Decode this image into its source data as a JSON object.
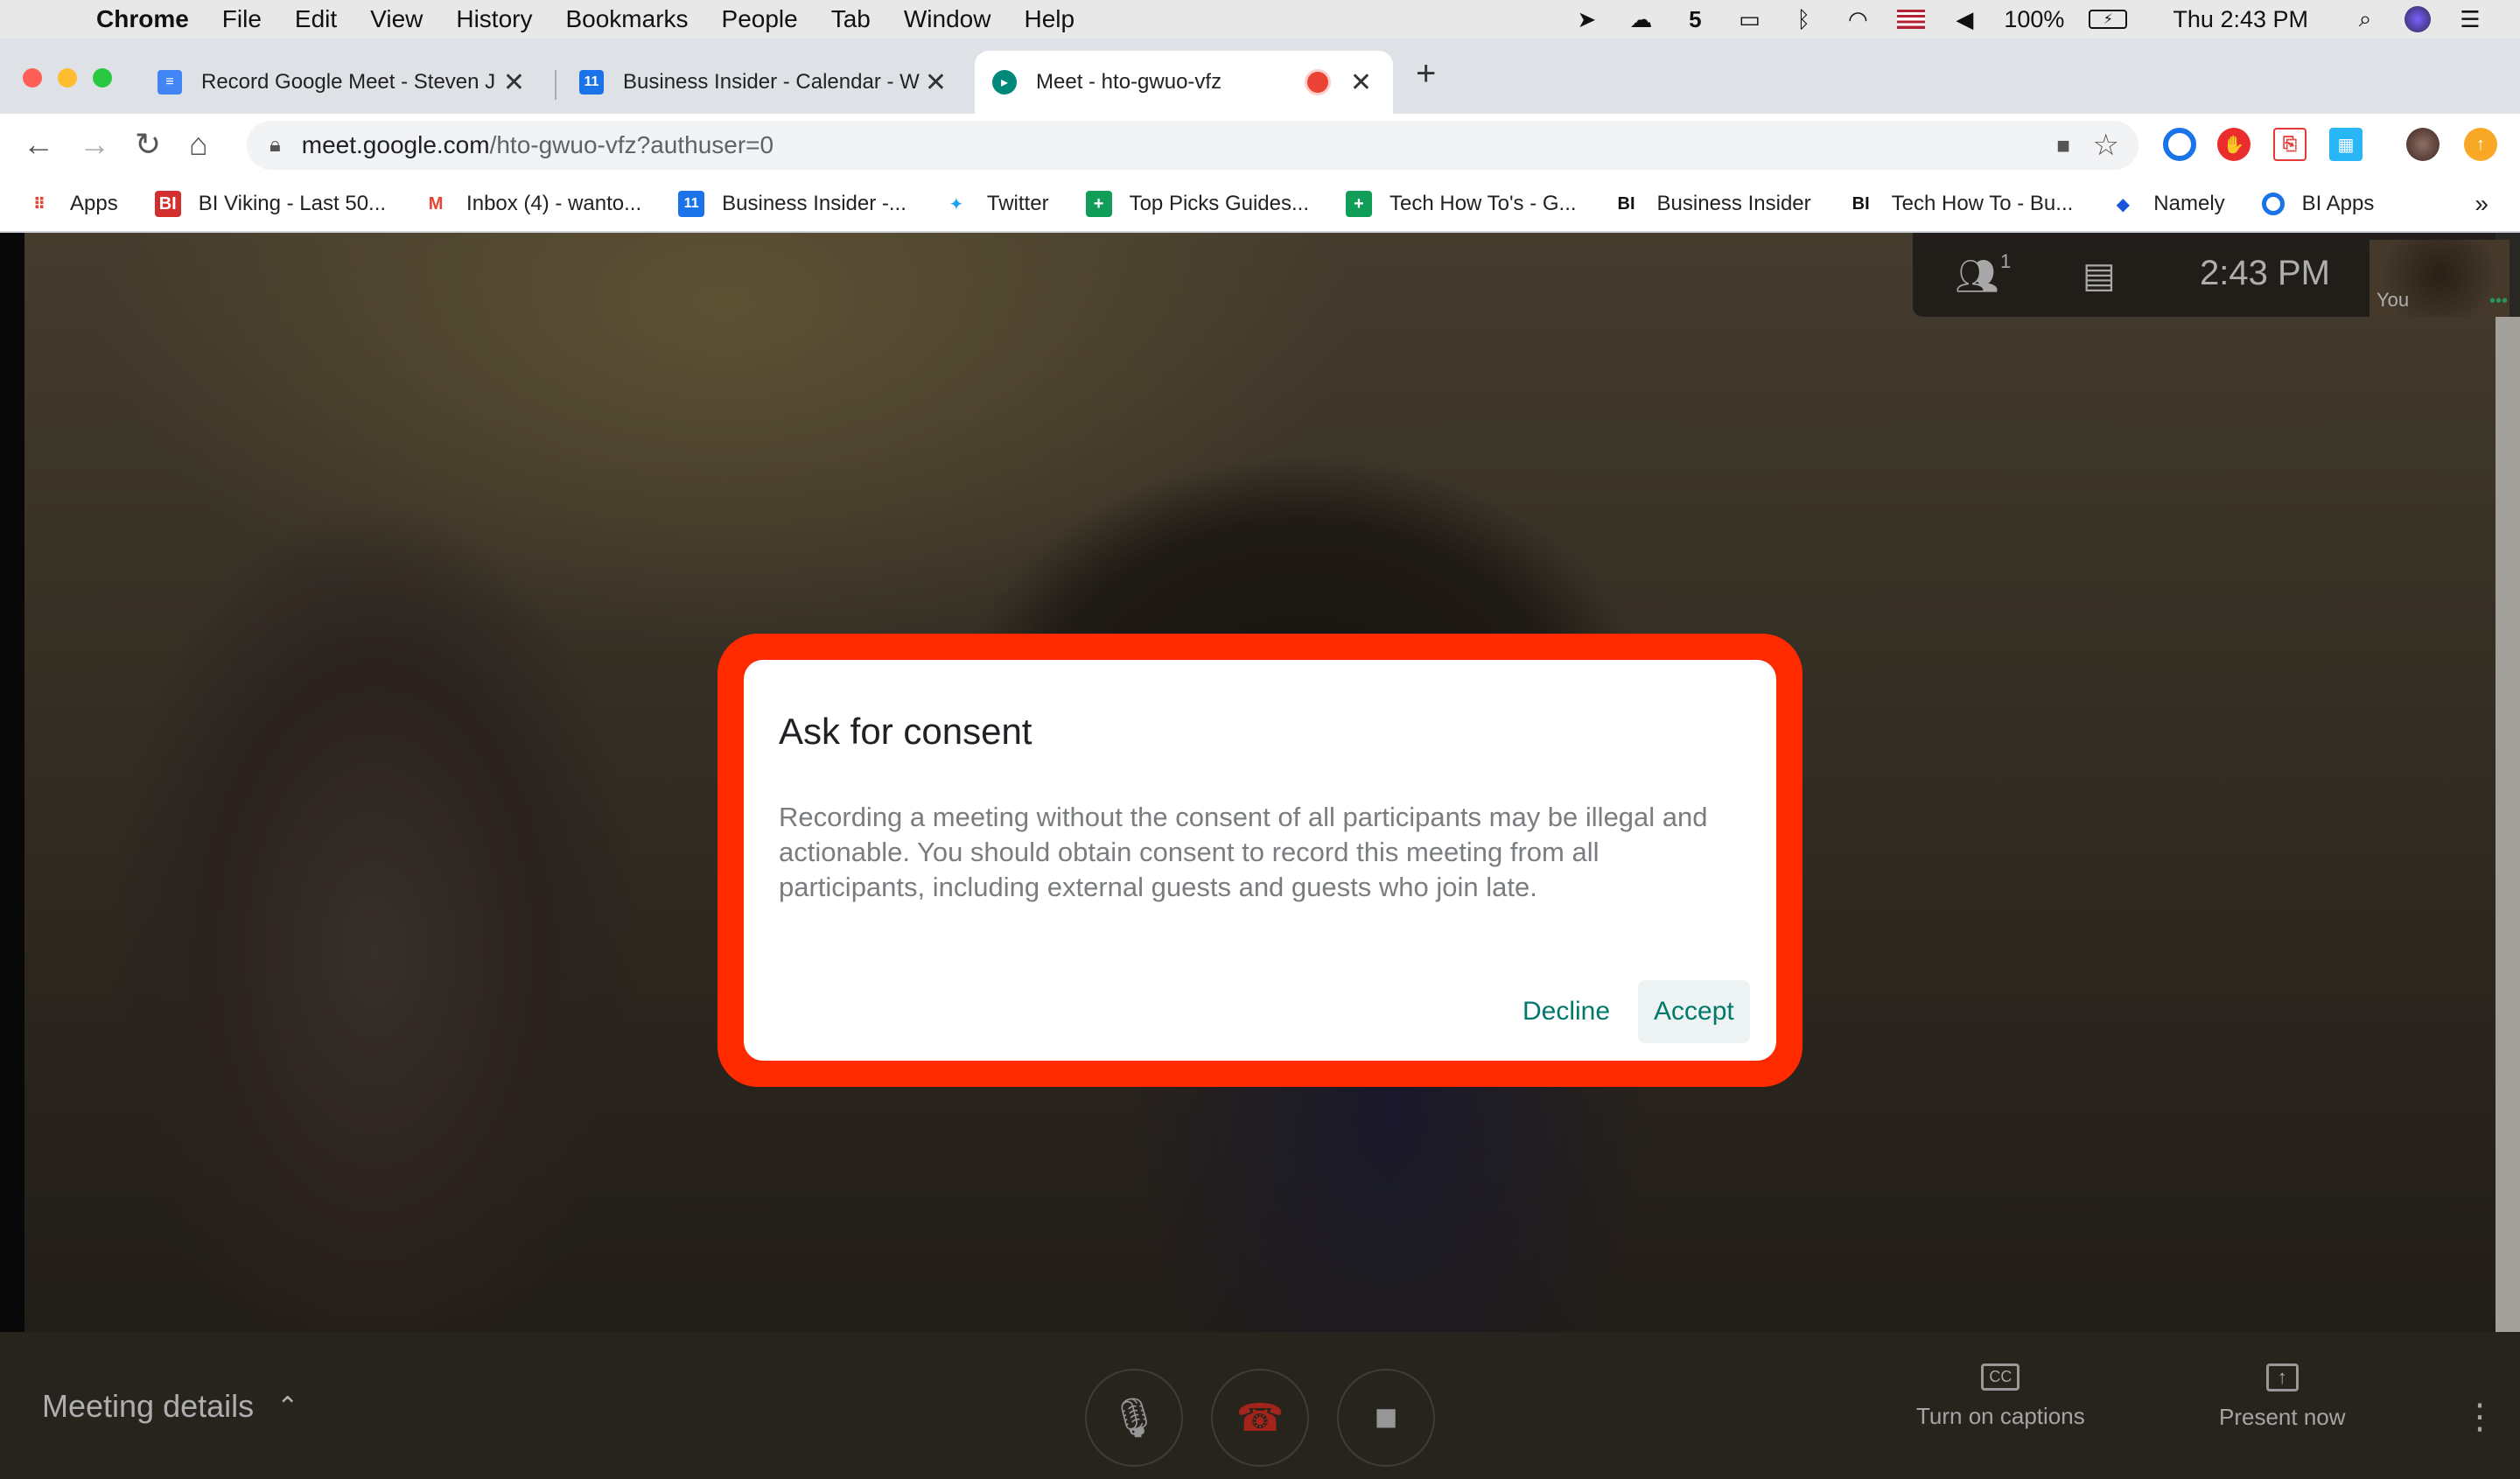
{
  "menubar": {
    "items": [
      "Chrome",
      "File",
      "Edit",
      "View",
      "History",
      "Bookmarks",
      "People",
      "Tab",
      "Window",
      "Help"
    ],
    "battery": "100%",
    "clock": "Thu 2:43 PM"
  },
  "tabs": [
    {
      "title": "Record Google Meet - Steven J",
      "favicon": "docs-icon",
      "color": "#4285f4"
    },
    {
      "title": "Business Insider - Calendar - W",
      "favicon": "calendar-icon",
      "color": "#1a73e8"
    },
    {
      "title": "Meet - hto-gwuo-vfz",
      "favicon": "meet-icon",
      "color": "#00897b",
      "active": true
    }
  ],
  "toolbar": {
    "url_host": "meet.google.com",
    "url_path": "/hto-gwuo-vfz?authuser=0"
  },
  "bookmarks": [
    {
      "label": "Apps",
      "icon": "apps-grid-icon",
      "glyph": "⋮⋮",
      "color": "#ea4335"
    },
    {
      "label": "BI Viking - Last 50...",
      "icon": "bi-icon",
      "glyph": "B|",
      "color": "#d32f2f"
    },
    {
      "label": "Inbox (4) - wanto...",
      "icon": "gmail-icon",
      "glyph": "M",
      "color": "#ea4335"
    },
    {
      "label": "Business Insider -...",
      "icon": "calendar-icon",
      "glyph": "11",
      "color": "#1a73e8"
    },
    {
      "label": "Twitter",
      "icon": "twitter-icon",
      "glyph": "✦",
      "color": "#1da1f2"
    },
    {
      "label": "Top Picks Guides...",
      "icon": "sheets-icon",
      "glyph": "+",
      "color": "#0f9d58"
    },
    {
      "label": "Tech How To's - G...",
      "icon": "sheets-icon",
      "glyph": "+",
      "color": "#0f9d58"
    },
    {
      "label": "Business Insider",
      "icon": "bi-logo-icon",
      "glyph": "BI",
      "color": "#111111"
    },
    {
      "label": "Tech How To - Bu...",
      "icon": "bi-logo-icon",
      "glyph": "BI",
      "color": "#111111"
    },
    {
      "label": "Namely",
      "icon": "namely-icon",
      "glyph": "◆",
      "color": "#1a56db"
    },
    {
      "label": "BI Apps",
      "icon": "bi-apps-icon",
      "glyph": "○",
      "color": "#1a73e8"
    }
  ],
  "bookmarks_more": "»",
  "meet": {
    "participants_count": "1",
    "clock": "2:43 PM",
    "self_label": "You",
    "meeting_details": "Meeting details",
    "captions_label": "Turn on captions",
    "present_label": "Present now"
  },
  "dialog": {
    "title": "Ask for consent",
    "body": "Recording a meeting without the consent of all participants may be illegal and actionable. You should obtain consent to record this meeting from all participants, including external guests and guests who join late.",
    "decline": "Decline",
    "accept": "Accept"
  },
  "colors": {
    "highlight": "#ff2a00",
    "accent": "#00796b",
    "hangup": "#d93025"
  }
}
